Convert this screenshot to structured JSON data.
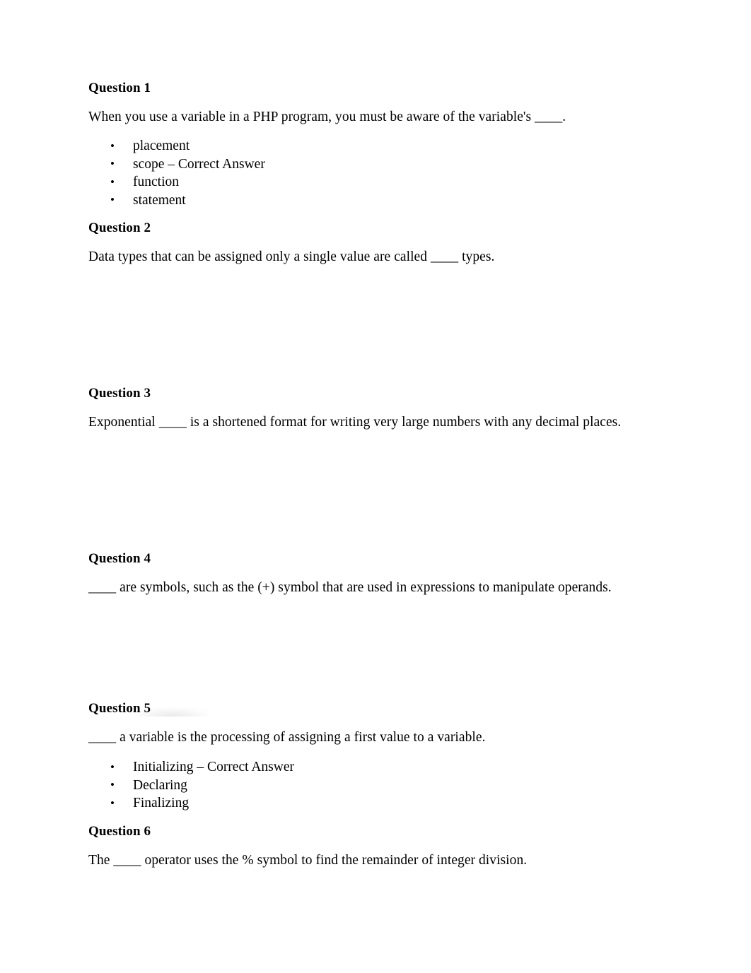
{
  "document": {
    "type": "quiz-worksheet",
    "background_color": "#ffffff",
    "text_color": "#000000"
  },
  "questions": [
    {
      "heading": "Question 1",
      "prompt": "When you use a variable in a PHP program, you must be aware of the variable's ____.",
      "options": [
        "placement",
        "scope – Correct Answer",
        "function",
        "statement"
      ]
    },
    {
      "heading": "Question 2",
      "prompt": "Data types that can be assigned only a single value are called ____ types.",
      "options": []
    },
    {
      "heading": "Question 3",
      "prompt": "Exponential ____ is a shortened format for writing very large numbers with any decimal places.",
      "options": []
    },
    {
      "heading": "Question 4",
      "prompt": "____ are symbols, such as the (+) symbol that are used in expressions to manipulate operands.",
      "options": []
    },
    {
      "heading": "Question 5",
      "prompt": "____ a variable is the processing of assigning a first value to a variable.",
      "options": [
        "Initializing – Correct Answer",
        "Declaring",
        "Finalizing"
      ]
    },
    {
      "heading": "Question 6",
      "prompt": "The ____ operator uses the % symbol to find the remainder of integer division.",
      "options": []
    }
  ]
}
